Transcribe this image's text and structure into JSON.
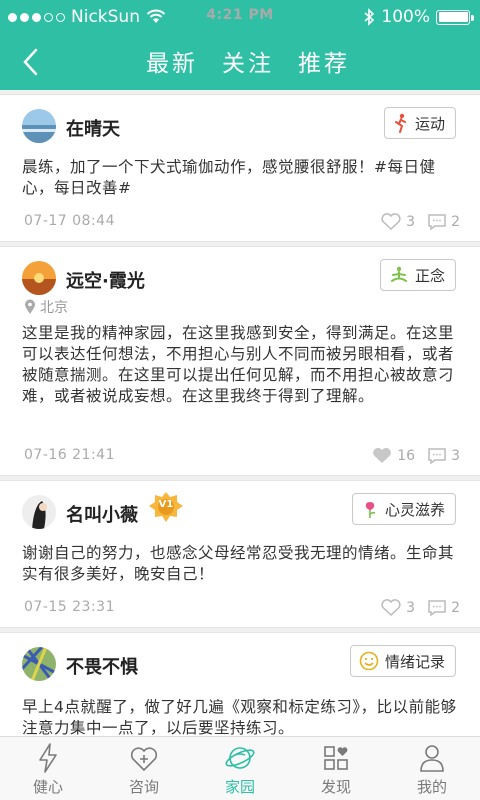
{
  "status_bar": {
    "carrier": "NickSun",
    "time": "4:21 PM",
    "battery": "100%"
  },
  "nav": {
    "tabs": [
      "最新",
      "关注",
      "推荐"
    ]
  },
  "posts": [
    {
      "user": "在晴天",
      "tag": "运动",
      "tag_icon": "runner-icon",
      "tag_color": "#e8503a",
      "content": "晨练，加了一个下犬式瑜伽动作，感觉腰很舒服！#每日健心，每日改善#",
      "time": "07-17 08:44",
      "likes": "3",
      "comments": "2"
    },
    {
      "user": "远空·霞光",
      "tag": "正念",
      "tag_icon": "meditation-icon",
      "tag_color": "#7cc14a",
      "location": "北京",
      "content": "这里是我的精神家园，在这里我感到安全，得到满足。在这里可以表达任何想法，不用担心与别人不同而被另眼相看，或者被随意揣测。在这里可以提出任何见解，而不用担心被故意刁难，或者被说成妄想。在这里我终于得到了理解。",
      "time": "07-16 21:41",
      "likes": "16",
      "comments": "3"
    },
    {
      "user": "名叫小薇",
      "badge": "V1",
      "tag": "心灵滋养",
      "tag_icon": "flower-icon",
      "tag_color": "#e8508a",
      "content": "谢谢自己的努力，也感念父母经常忍受我无理的情绪。生命其实有很多美好，晚安自己！",
      "time": "07-15 23:31",
      "likes": "3",
      "comments": "2"
    },
    {
      "user": "不畏不惧",
      "tag": "情绪记录",
      "tag_icon": "smile-icon",
      "tag_color": "#e6b21e",
      "content": "早上4点就醒了，做了好几遍《观察和标定练习》，比以前能够注意力集中一点了，以后要坚持练习。"
    }
  ],
  "tabbar": [
    {
      "label": "健心",
      "icon": "lightning-icon"
    },
    {
      "label": "咨询",
      "icon": "heart-plus-icon"
    },
    {
      "label": "家园",
      "icon": "planet-icon"
    },
    {
      "label": "发现",
      "icon": "grid-heart-icon"
    },
    {
      "label": "我的",
      "icon": "person-icon"
    }
  ],
  "colors": {
    "accent": "#2ebfa5"
  }
}
